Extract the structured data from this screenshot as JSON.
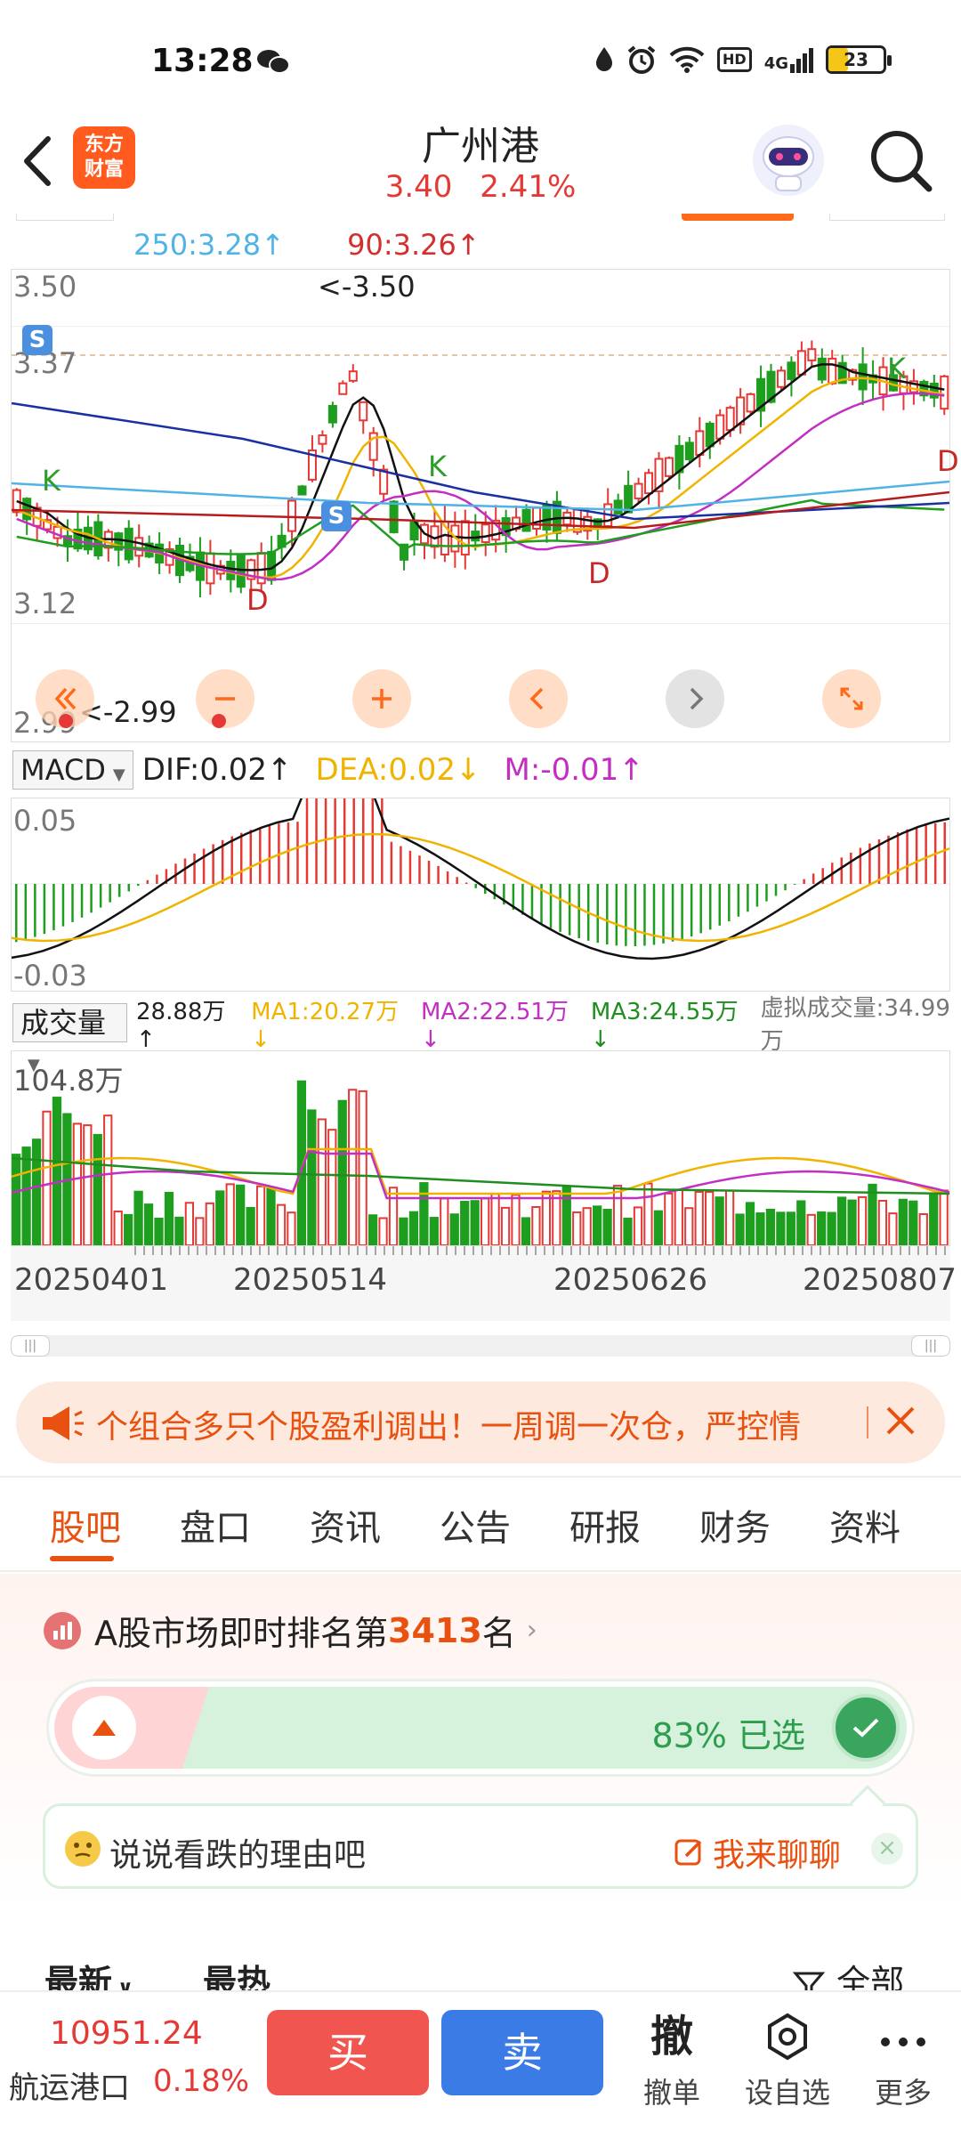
{
  "status_bar": {
    "time": "13:28",
    "battery": "23",
    "network": "4G",
    "hd": "HD"
  },
  "header": {
    "logo_line1": "东方",
    "logo_line2": "财富",
    "title": "广州港",
    "price": "3.40",
    "change_pct": "2.41%"
  },
  "ma_summary": {
    "ma250": "250:3.28↑",
    "ma90": "90:3.26↑"
  },
  "kline": {
    "price_axis": [
      "3.50",
      "3.37",
      "3.12",
      "2.99"
    ],
    "high_label": "<-3.50",
    "low_label": "<-2.99",
    "marks": {
      "d": "D",
      "k": "K",
      "s": "S"
    }
  },
  "macd": {
    "selector": "MACD",
    "dif": "DIF:0.02↑",
    "dea": "DEA:0.02↓",
    "m": "M:-0.01↑",
    "axis_top": "0.05",
    "axis_bottom": "-0.03"
  },
  "volume": {
    "selector": "成交量",
    "vol": "28.88万↑",
    "ma1": "MA1:20.27万↓",
    "ma2": "MA2:22.51万↓",
    "ma3": "MA3:24.55万↓",
    "virtual": "虚拟成交量:34.99万",
    "axis_top": "104.8万"
  },
  "dates": [
    "20250401",
    "20250514",
    "20250626",
    "20250807"
  ],
  "banner": {
    "text": "个组合多只个股盈利调出！一周调一次仓，严控情"
  },
  "tabs": [
    "股吧",
    "盘口",
    "资讯",
    "公告",
    "研报",
    "财务",
    "资料"
  ],
  "rank": {
    "prefix": "A股市场即时排名第",
    "number": "3413",
    "suffix": "名"
  },
  "vote": {
    "text": "83% 已选"
  },
  "comment": {
    "placeholder": "说说看跌的理由吧",
    "action": "我来聊聊"
  },
  "sort": {
    "latest": "最新",
    "hot": "最热",
    "all": "全部"
  },
  "bottom": {
    "index_value": "10951.24",
    "index_name": "航运港口",
    "index_pct": "0.18%",
    "buy": "买",
    "sell": "卖",
    "cancel_big": "撤",
    "cancel": "撤单",
    "watch": "设自选",
    "more": "更多"
  },
  "colors": {
    "up": "#e53935",
    "down": "#1e9e1e",
    "accent": "#e8510f"
  }
}
